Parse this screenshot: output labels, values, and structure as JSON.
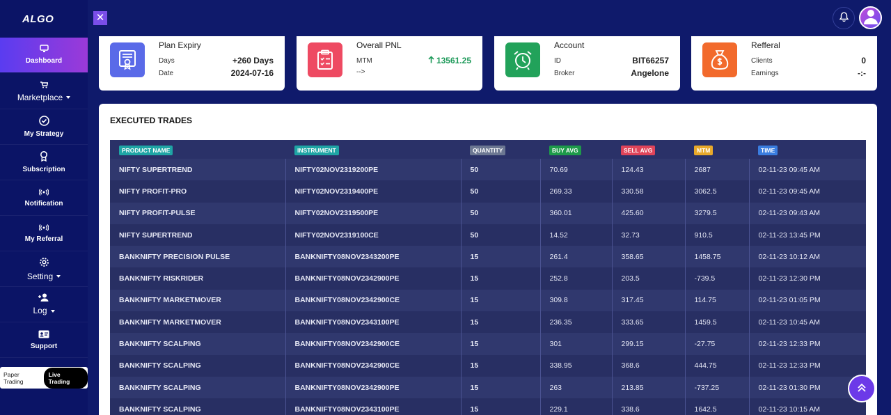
{
  "logo": "ALGO",
  "sidebar": {
    "items": [
      {
        "label": "Dashboard"
      },
      {
        "label": "Marketplace"
      },
      {
        "label": "My Strategy"
      },
      {
        "label": "Subscription"
      },
      {
        "label": "Notification"
      },
      {
        "label": "My Referral"
      },
      {
        "label": "Setting"
      },
      {
        "label": "Log"
      },
      {
        "label": "Support"
      }
    ],
    "mode_paper": "Paper Trading",
    "mode_live": "Live Trading"
  },
  "topbar": {
    "close_symbol": "✕"
  },
  "cards": {
    "plan": {
      "title": "Plan Expiry",
      "days_label": "Days",
      "days_value": "+260 Days",
      "date_label": "Date",
      "date_value": "2024-07-16"
    },
    "pnl": {
      "title": "Overall PNL",
      "mtm_label": "MTM",
      "mtm_value": "13561.25",
      "arrow_label": "-->"
    },
    "account": {
      "title": "Account",
      "id_label": "ID",
      "id_value": "BIT66257",
      "broker_label": "Broker",
      "broker_value": "Angelone"
    },
    "referral": {
      "title": "Refferal",
      "clients_label": "Clients",
      "clients_value": "0",
      "earnings_label": "Earnings",
      "earnings_value": "-:-"
    }
  },
  "trades": {
    "title": "EXECUTED TRADES",
    "columns": [
      {
        "label": "PRODUCT NAME",
        "color": "#1fa5a5"
      },
      {
        "label": "INSTRUMENT",
        "color": "#1fa5a5"
      },
      {
        "label": "QUANTITY",
        "color": "#6c7792"
      },
      {
        "label": "BUY AVG",
        "color": "#1e9a4a"
      },
      {
        "label": "SELL AVG",
        "color": "#e0445a"
      },
      {
        "label": "MTM",
        "color": "#e8a92a"
      },
      {
        "label": "TIME",
        "color": "#3a7de0"
      }
    ],
    "rows": [
      [
        "NIFTY SUPERTREND",
        "NIFTY02NOV2319200PE",
        "50",
        "70.69",
        "124.43",
        "2687",
        "02-11-23 09:45 AM"
      ],
      [
        "NIFTY PROFIT-PRO",
        "NIFTY02NOV2319400PE",
        "50",
        "269.33",
        "330.58",
        "3062.5",
        "02-11-23 09:45 AM"
      ],
      [
        "NIFTY PROFIT-PULSE",
        "NIFTY02NOV2319500PE",
        "50",
        "360.01",
        "425.60",
        "3279.5",
        "02-11-23 09:43 AM"
      ],
      [
        "NIFTY SUPERTREND",
        "NIFTY02NOV2319100CE",
        "50",
        "14.52",
        "32.73",
        "910.5",
        "02-11-23 13:45 PM"
      ],
      [
        "BANKNIFTY PRECISION PULSE",
        "BANKNIFTY08NOV2343200PE",
        "15",
        "261.4",
        "358.65",
        "1458.75",
        "02-11-23 10:12 AM"
      ],
      [
        "BANKNIFTY RISKRIDER",
        "BANKNIFTY08NOV2342900PE",
        "15",
        "252.8",
        "203.5",
        "-739.5",
        "02-11-23 12:30 PM"
      ],
      [
        "BANKNIFTY MARKETMOVER",
        "BANKNIFTY08NOV2342900CE",
        "15",
        "309.8",
        "317.45",
        "114.75",
        "02-11-23 01:05 PM"
      ],
      [
        "BANKNIFTY MARKETMOVER",
        "BANKNIFTY08NOV2343100PE",
        "15",
        "236.35",
        "333.65",
        "1459.5",
        "02-11-23 10:45 AM"
      ],
      [
        "BANKNIFTY SCALPING",
        "BANKNIFTY08NOV2342900CE",
        "15",
        "301",
        "299.15",
        "-27.75",
        "02-11-23 12:33 PM"
      ],
      [
        "BANKNIFTY SCALPING",
        "BANKNIFTY08NOV2342900CE",
        "15",
        "338.95",
        "368.6",
        "444.75",
        "02-11-23 12:33 PM"
      ],
      [
        "BANKNIFTY SCALPING",
        "BANKNIFTY08NOV2342900PE",
        "15",
        "263",
        "213.85",
        "-737.25",
        "02-11-23 01:30 PM"
      ],
      [
        "BANKNIFTY SCALPING",
        "BANKNIFTY08NOV2343100PE",
        "15",
        "229.1",
        "338.6",
        "1642.5",
        "02-11-23 10:15 AM"
      ]
    ]
  }
}
